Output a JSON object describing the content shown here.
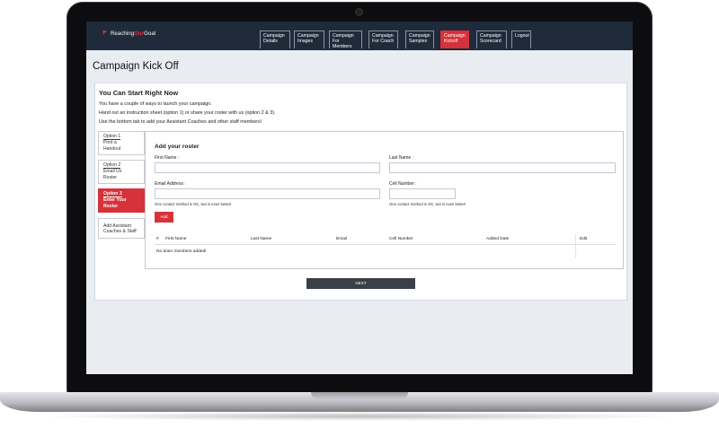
{
  "logo": {
    "text_a": "Reaching",
    "text_b": "Our",
    "text_c": "Goal"
  },
  "nav": [
    {
      "line1": "Campaign",
      "line2": "Details"
    },
    {
      "line1": "Campaign",
      "line2": "Images"
    },
    {
      "line1": "Campaign",
      "line2": "For Members"
    },
    {
      "line1": "Campaign",
      "line2": "For Coach"
    },
    {
      "line1": "Campaign",
      "line2": "Samples"
    },
    {
      "line1": "Campaign",
      "line2": "Kickoff"
    },
    {
      "line1": "Campaign",
      "line2": "Scorecard"
    },
    {
      "line1": "Logout",
      "line2": ""
    }
  ],
  "page": {
    "title": "Campaign Kick Off"
  },
  "card": {
    "heading": "You Can Start Right Now",
    "intro": [
      "You have a couple of ways to launch your campaign.",
      "Hand out an instruction sheet (option 1) or share your roster with us (option 2 & 3).",
      "Use the bottom tab to add your Assistant Coaches and other staff members!"
    ]
  },
  "tabs": [
    {
      "opt": "Option 1",
      "l1": "Print a",
      "l2": "Handout"
    },
    {
      "opt": "Option 2",
      "l1": "Email Us",
      "l2": "Roster"
    },
    {
      "opt": "Option 3",
      "l1": "Enter Your",
      "l2": "Roster"
    },
    {
      "opt": "",
      "l1": "Add Assistant",
      "l2": "Coaches & Staff"
    }
  ],
  "roster": {
    "title": "Add your roster",
    "first_name_label": "First Name :",
    "last_name_label": "Last Name :",
    "email_label": "Email Address :",
    "cell_label": "Cell Number :",
    "hint": "One contact method is OK, two is even better!",
    "add_label": "Add",
    "columns": [
      "#",
      "First Name",
      "Last Name",
      "Email",
      "Cell Number",
      "Added Date",
      "Edit"
    ],
    "empty_text": "No team members added!"
  },
  "footer": {
    "next_label": "NEXT"
  },
  "colors": {
    "header": "#1f2a3a",
    "accent": "#d6323b",
    "button_dark": "#3b3f46"
  }
}
